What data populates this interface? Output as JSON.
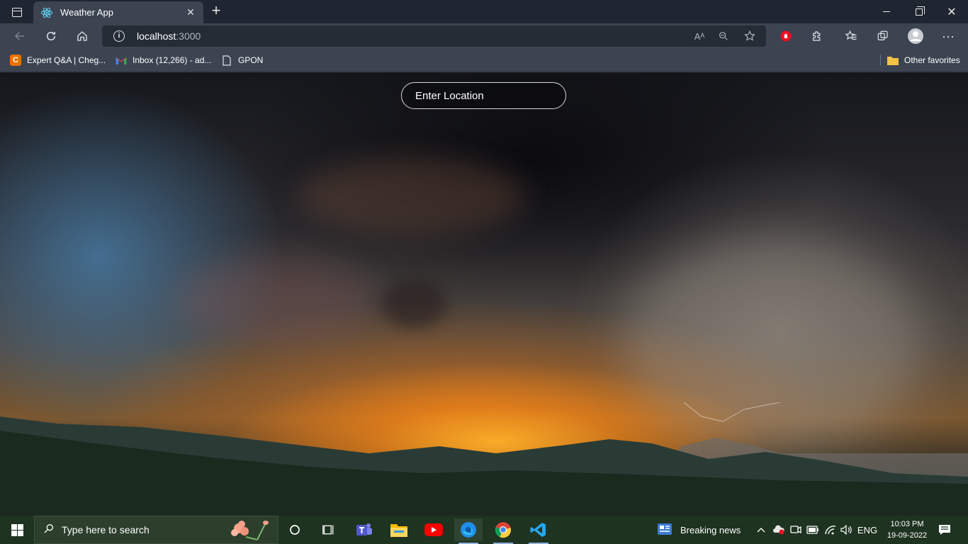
{
  "browser": {
    "tab": {
      "title": "Weather App",
      "favicon": "react-logo-icon"
    },
    "new_tab_label": "+",
    "address": {
      "host": "localhost",
      "port": ":3000"
    },
    "toolbar_icons": [
      "back-icon",
      "refresh-icon",
      "home-icon",
      "read-aloud-icon",
      "zoom-out-icon",
      "add-favorite-icon",
      "extension-red-icon",
      "extensions-icon",
      "favorites-icon",
      "collections-icon",
      "profile-icon",
      "more-icon"
    ],
    "bookmarks": [
      {
        "label": "Expert Q&A | Cheg...",
        "icon": "chegg-icon",
        "color": "#e87100"
      },
      {
        "label": "Inbox (12,266) - ad...",
        "icon": "gmail-icon",
        "color": "#ea4335"
      },
      {
        "label": "GPON",
        "icon": "page-icon",
        "color": "#ffffff"
      }
    ],
    "other_favorites": "Other favorites"
  },
  "page": {
    "search_placeholder": "Enter Location"
  },
  "taskbar": {
    "search_placeholder": "Type here to search",
    "news": "Breaking news",
    "language": "ENG",
    "time": "10:03 PM",
    "date": "19-09-2022",
    "apps": [
      "cortana-icon",
      "task-view-icon",
      "teams-icon",
      "file-explorer-icon",
      "youtube-icon",
      "edge-icon",
      "chrome-icon",
      "vscode-icon"
    ]
  },
  "colors": {
    "edge_dark": "#1f2631",
    "edge_toolbar": "#3c4452",
    "taskbar": "#1e3320",
    "youtube": "#ff0000",
    "edge_blue": "#1f8ee9"
  }
}
